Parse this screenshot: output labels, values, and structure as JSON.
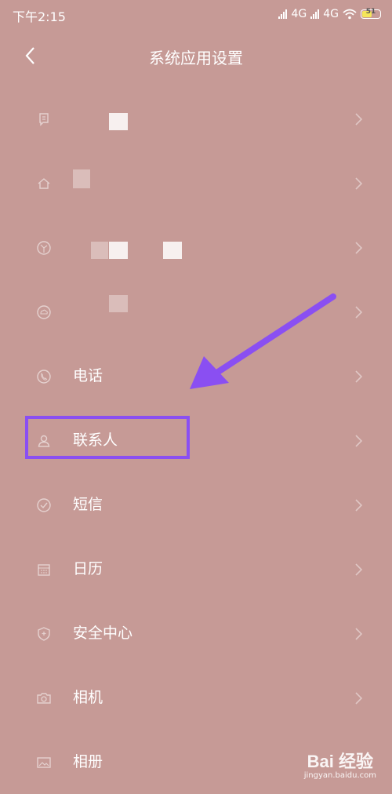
{
  "status_bar": {
    "time": "下午2:15",
    "network_1": "4G",
    "network_2": "4G",
    "battery": "51"
  },
  "header": {
    "title": "系统应用设置",
    "back_icon": "chevron-left-icon"
  },
  "list": {
    "items": [
      {
        "label": "",
        "icon": "message-icon"
      },
      {
        "label": "",
        "icon": "home-icon"
      },
      {
        "label": "",
        "icon": "theme-icon"
      },
      {
        "label": "",
        "icon": "cloud-icon"
      },
      {
        "label": "电话",
        "icon": "phone-icon"
      },
      {
        "label": "联系人",
        "icon": "person-icon"
      },
      {
        "label": "短信",
        "icon": "check-circle-icon"
      },
      {
        "label": "日历",
        "icon": "calendar-icon"
      },
      {
        "label": "安全中心",
        "icon": "shield-icon"
      },
      {
        "label": "相机",
        "icon": "camera-icon"
      },
      {
        "label": "相册",
        "icon": "image-icon"
      }
    ]
  },
  "annotation": {
    "highlight_color": "#8a4ff2",
    "arrow_color": "#8a4ff2"
  },
  "watermark": {
    "logo": "Bai 经验",
    "url": "jingyan.baidu.com"
  },
  "colors": {
    "background": "#c69a96",
    "text": "#ffffff"
  }
}
